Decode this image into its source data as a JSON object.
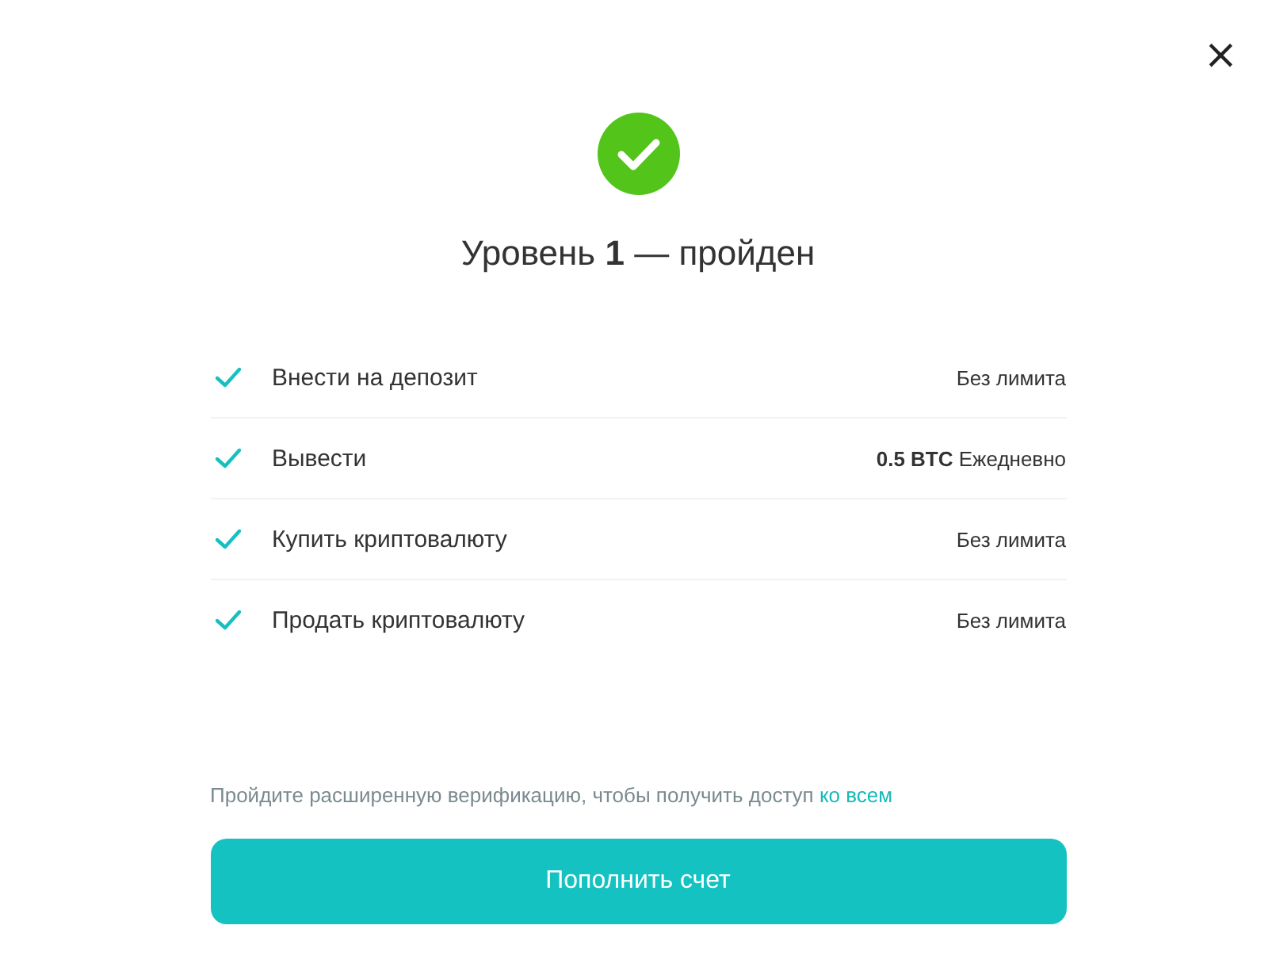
{
  "close": {
    "label": "×"
  },
  "title": "Уровень **1** — пройден",
  "limits": [
    {
      "name": "Внести на депозит",
      "value": "Без лимита",
      "done": true
    },
    {
      "name": "Вывести",
      "value": "**0.5 BTC** Ежедневно",
      "done": true
    },
    {
      "name": "Купить криптовалюту",
      "value": "Без лимита",
      "done": true
    },
    {
      "name": "Продать криптовалюту",
      "value": "Без лимита",
      "done": true
    }
  ],
  "hint": {
    "text": "Пройдите расширенную верификацию, чтобы получить доступ",
    "link": "ко всем"
  },
  "button": "Пополнить счет"
}
